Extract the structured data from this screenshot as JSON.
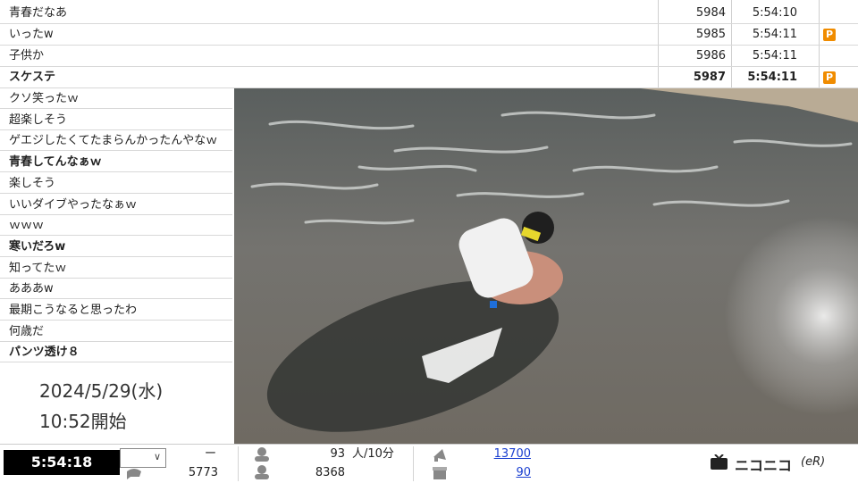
{
  "top_comments": [
    {
      "text": "青春だなあ",
      "number": "5984",
      "time": "5:54:10",
      "premium": false,
      "bold": false
    },
    {
      "text": "いったw",
      "number": "5985",
      "time": "5:54:11",
      "premium": true,
      "bold": false
    },
    {
      "text": "子供か",
      "number": "5986",
      "time": "5:54:11",
      "premium": false,
      "bold": false
    },
    {
      "text": "スケステ",
      "number": "5987",
      "time": "5:54:11",
      "premium": true,
      "bold": true
    }
  ],
  "premium_badge": "P",
  "side_comments": [
    {
      "text": "クソ笑ったｗ",
      "bold": false
    },
    {
      "text": "超楽しそう",
      "bold": false
    },
    {
      "text": "ゲエジしたくてたまらんかったんやなｗ",
      "bold": false
    },
    {
      "text": "青春してんなぁｗ",
      "bold": true
    },
    {
      "text": "楽しそう",
      "bold": false
    },
    {
      "text": "いいダイブやったなぁｗ",
      "bold": false
    },
    {
      "text": "ｗｗｗ",
      "bold": false
    },
    {
      "text": "寒いだろw",
      "bold": true
    },
    {
      "text": "知ってたｗ",
      "bold": false
    },
    {
      "text": "あああw",
      "bold": false
    },
    {
      "text": "最期こうなると思ったわ",
      "bold": false
    },
    {
      "text": "何歳だ",
      "bold": false
    },
    {
      "text": "パンツ透け８",
      "bold": true
    }
  ],
  "broadcast": {
    "date": "2024/5/29(水)",
    "start": "10:52開始"
  },
  "status": {
    "elapsed": "5:54:18",
    "dash": "ー",
    "comments_total": "5773",
    "active_users": "93",
    "active_unit": "人/10分",
    "visitors": "8368",
    "ad_points": "13700",
    "gift_points": "90"
  },
  "logo": {
    "text": "ニコニコ",
    "sub": "(eR)"
  },
  "colors": {
    "premium": "#f08c00",
    "link": "#1a3fd0",
    "clock_bg": "#000000"
  }
}
